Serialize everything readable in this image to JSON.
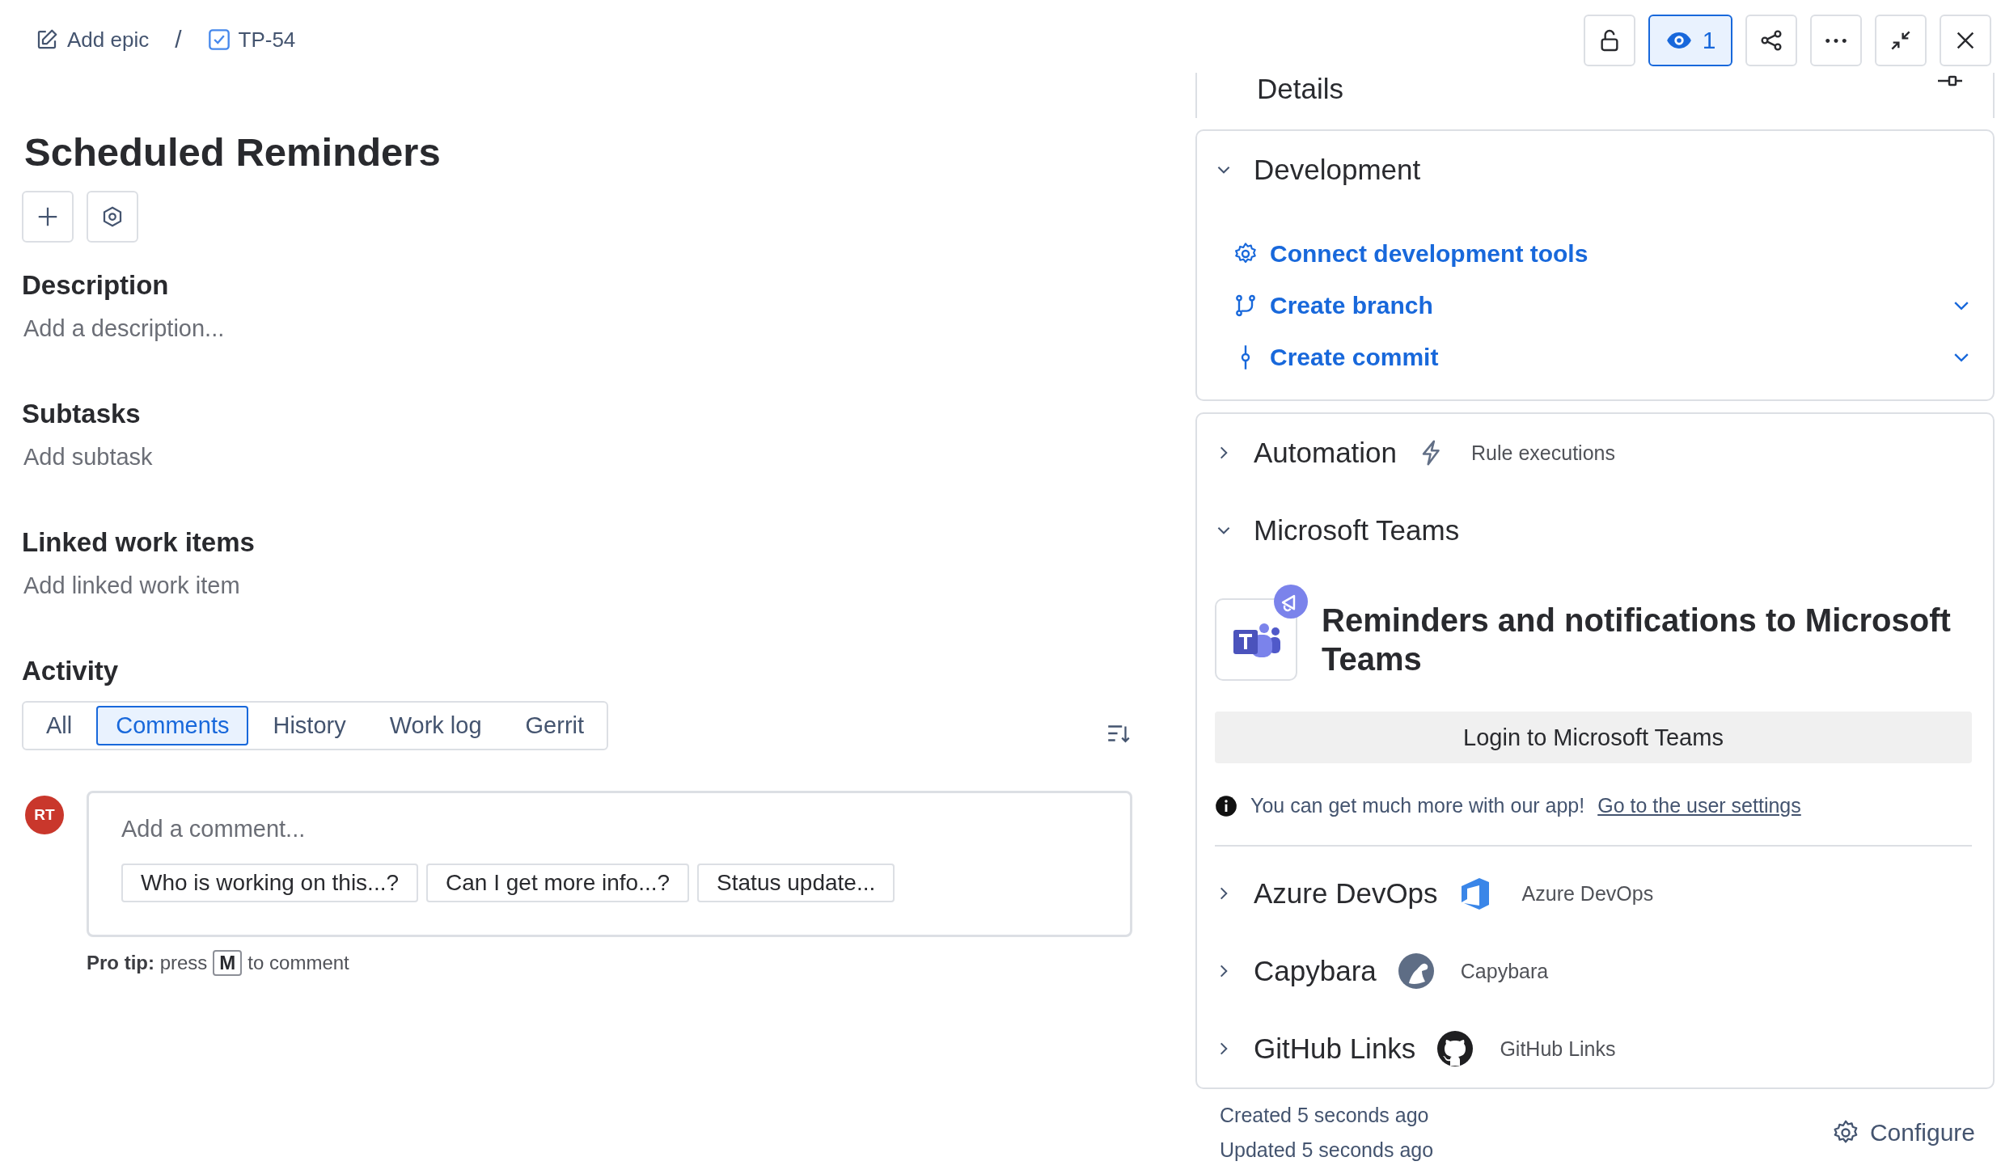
{
  "breadcrumb": [
    {
      "kind": "epic",
      "label": "Add epic"
    },
    {
      "kind": "task",
      "label": "TP-54"
    }
  ],
  "breadcrumb_separator": "/",
  "toolbar": [
    {
      "kind": "lock",
      "on": false
    },
    {
      "kind": "watch",
      "on": true,
      "count": "1"
    },
    {
      "kind": "share",
      "on": false
    },
    {
      "kind": "more",
      "on": false
    },
    {
      "kind": "minimize",
      "on": false
    },
    {
      "kind": "close",
      "on": false
    }
  ],
  "title": "Scheduled Reminders",
  "sections": [
    {
      "heading": "Description",
      "placeholder": "Add a description..."
    },
    {
      "heading": "Subtasks",
      "placeholder": "Add subtask"
    },
    {
      "heading": "Linked work items",
      "placeholder": "Add linked work item"
    }
  ],
  "activity": {
    "heading": "Activity",
    "tabs": [
      {
        "label": "All",
        "selected": false
      },
      {
        "label": "Comments",
        "selected": true
      },
      {
        "label": "History",
        "selected": false
      },
      {
        "label": "Work log",
        "selected": false
      },
      {
        "label": "Gerrit",
        "selected": false
      }
    ],
    "avatar": "RT",
    "comment_placeholder": "Add a comment...",
    "suggestions": [
      "Who is working on this...?",
      "Can I get more info...?",
      "Status update..."
    ],
    "pro_tip": {
      "text": "**Pro tip:** press",
      "key": "M",
      "after": "to comment"
    }
  },
  "details": {
    "title": "Details"
  },
  "development": {
    "title": "Development",
    "expanded": true,
    "actions": [
      {
        "kind": "connect",
        "label": "Connect development tools",
        "dropdown": false
      },
      {
        "kind": "branch",
        "label": "Create branch",
        "dropdown": true
      },
      {
        "kind": "commit",
        "label": "Create commit",
        "dropdown": true
      }
    ]
  },
  "apps": [
    {
      "kind": "automation",
      "title": "Automation",
      "expanded": false,
      "caption": "Rule executions"
    },
    {
      "kind": "teams",
      "title": "Microsoft Teams",
      "expanded": true,
      "heading": "Reminders and notifications to Microsoft Teams",
      "button": "Login to Microsoft Teams",
      "info": "You can get much more with our app!",
      "link": "Go to the user settings"
    },
    {
      "kind": "azure",
      "title": "Azure DevOps",
      "expanded": false,
      "caption": "Azure DevOps"
    },
    {
      "kind": "capybara",
      "title": "Capybara",
      "expanded": false,
      "caption": "Capybara"
    },
    {
      "kind": "github",
      "title": "GitHub Links",
      "expanded": false,
      "caption": "GitHub Links"
    }
  ],
  "footer": {
    "created": "Created 5 seconds ago",
    "updated": "Updated 5 seconds ago",
    "configure": "Configure"
  }
}
